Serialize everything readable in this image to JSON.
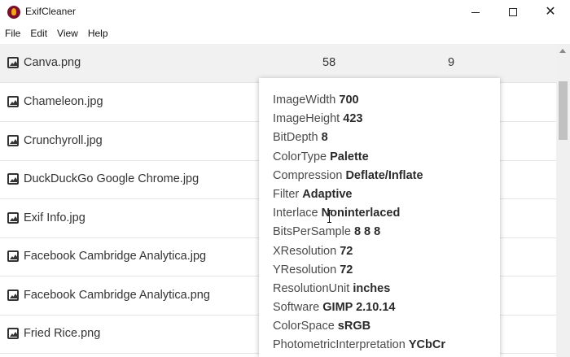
{
  "window": {
    "title": "ExifCleaner"
  },
  "menu": [
    "File",
    "Edit",
    "View",
    "Help"
  ],
  "files": [
    {
      "name": "Canva.png",
      "before": "58",
      "after": "9",
      "selected": true
    },
    {
      "name": "Chameleon.jpg"
    },
    {
      "name": "Crunchyroll.jpg"
    },
    {
      "name": "DuckDuckGo Google Chrome.jpg"
    },
    {
      "name": "Exif Info.jpg"
    },
    {
      "name": "Facebook Cambridge Analytica.jpg"
    },
    {
      "name": "Facebook Cambridge Analytica.png"
    },
    {
      "name": "Fried Rice.png"
    }
  ],
  "metadata": [
    {
      "key": "ImageWidth",
      "value": "700"
    },
    {
      "key": "ImageHeight",
      "value": "423"
    },
    {
      "key": "BitDepth",
      "value": "8"
    },
    {
      "key": "ColorType",
      "value": "Palette"
    },
    {
      "key": "Compression",
      "value": "Deflate/Inflate"
    },
    {
      "key": "Filter",
      "value": "Adaptive"
    },
    {
      "key": "Interlace",
      "value": "Noninterlaced"
    },
    {
      "key": "BitsPerSample",
      "value": "8 8 8"
    },
    {
      "key": "XResolution",
      "value": "72"
    },
    {
      "key": "YResolution",
      "value": "72"
    },
    {
      "key": "ResolutionUnit",
      "value": "inches"
    },
    {
      "key": "Software",
      "value": "GIMP 2.10.14"
    },
    {
      "key": "ColorSpace",
      "value": "sRGB"
    },
    {
      "key": "PhotometricInterpretation",
      "value": "YCbCr"
    }
  ],
  "icons": {
    "app": "exifcleaner-logo-icon",
    "file": "image-file-icon",
    "minimize": "minimize-icon",
    "maximize": "maximize-icon",
    "close": "close-icon"
  }
}
